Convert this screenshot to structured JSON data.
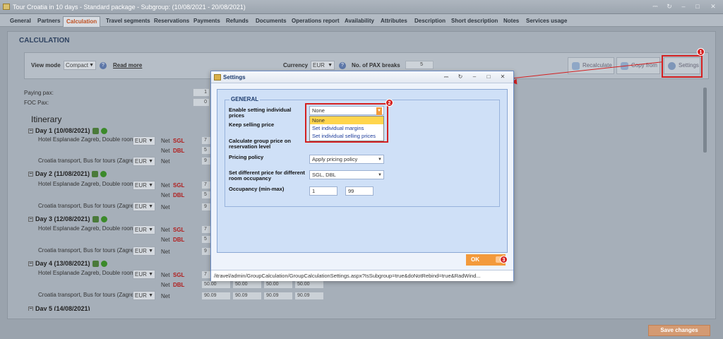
{
  "window": {
    "title": "Tour Croatia in 10 days - Standard package - Subgroup: (10/08/2021 - 20/08/2021)"
  },
  "tabs": [
    "General",
    "Partners",
    "Calculation",
    "Travel segments",
    "Reservations",
    "Payments",
    "Refunds",
    "Documents",
    "Operations report",
    "Availability",
    "Attributes",
    "Description",
    "Short description",
    "Notes",
    "Services usage"
  ],
  "calc": {
    "title": "CALCULATION",
    "view_mode_label": "View mode",
    "view_mode_value": "Compact",
    "read_more": "Read more",
    "currency_label": "Currency",
    "currency_value": "EUR",
    "pax_breaks_label": "No. of PAX breaks",
    "pax_breaks_value": "5",
    "recalculate": "Recalculate",
    "copy_from": "Copy from",
    "settings": "Settings",
    "paying_pax": "Paying pax:",
    "paying_pax_value": "1",
    "foc_pax": "FOC Pax:",
    "foc_pax_value": "0",
    "itinerary": "Itinerary",
    "days": [
      {
        "label": "Day 1 (10/08/2021)",
        "hotel": "Hotel Esplanade Zagreb, Double room",
        "transport": "Croatia transport, Bus for tours (Zagre",
        "v1": "7",
        "v2": "5",
        "v3": "9"
      },
      {
        "label": "Day 2 (11/08/2021)",
        "hotel": "Hotel Esplanade Zagreb, Double room",
        "transport": "Croatia transport, Bus for tours (Zagre",
        "v1": "7",
        "v2": "5",
        "v3": "9"
      },
      {
        "label": "Day 3 (12/08/2021)",
        "hotel": "Hotel Esplanade Zagreb, Double room",
        "transport": "Croatia transport, Bus for tours (Zagre",
        "v1": "7",
        "v2": "5",
        "v3": "9"
      },
      {
        "label": "Day 4 (13/08/2021)",
        "hotel": "Hotel Esplanade Zagreb, Double room",
        "transport": "Croatia transport, Bus for tours (Zagre",
        "v1": "7",
        "v2": "50.00",
        "v3": "90.09"
      }
    ],
    "day5_label": "Day 5 (14/08/2021)",
    "cur": "EUR",
    "net": "Net",
    "sgl": "SGL",
    "dbl": "DBL",
    "day4_dbl_cells": [
      "50.00",
      "50.00",
      "50.00",
      "50.00"
    ],
    "day4_net_cells": [
      "90.09",
      "90.09",
      "90.09",
      "90.09"
    ],
    "save_changes": "Save changes"
  },
  "modal": {
    "title": "Settings",
    "legend": "GENERAL",
    "f1_label": "Enable setting individual prices",
    "f1_value": "None",
    "f2_label": "Keep selling price",
    "f3_label": "Calculate group price on reservation level",
    "f4_label": "Pricing policy",
    "f4_value": "Apply pricing policy",
    "f5_label": "Set different price for different room occupancy",
    "f5_value": "SGL, DBL",
    "f6_label": "Occupancy (min-max)",
    "f6_min": "1",
    "f6_max": "99",
    "dropdown_options": [
      "None",
      "Set individual margins",
      "Set individual selling prices"
    ],
    "ok": "OK",
    "status_url": "/itravel/admin/GroupCalculation/GroupCalculationSettings.aspx?IsSubgroup=true&doNotRebind=true&RadWind..."
  },
  "badges": [
    "1",
    "2",
    "3"
  ],
  "colors": {
    "accent": "#d42020",
    "ok": "#f39a3b",
    "modal_bg": "#cfe0f7"
  }
}
